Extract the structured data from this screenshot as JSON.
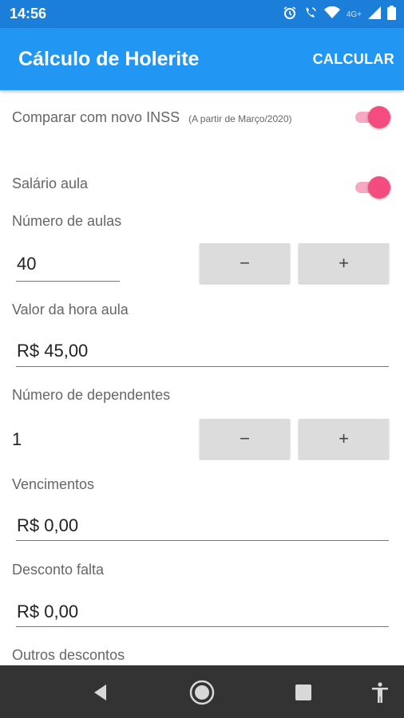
{
  "status_bar": {
    "time": "14:56",
    "network_label": "4G+",
    "icons": [
      "alarm-icon",
      "wifi-calling-icon",
      "wifi-icon",
      "signal-icon",
      "battery-icon"
    ]
  },
  "app_bar": {
    "title": "Cálculo de Holerite",
    "action_label": "CALCULAR"
  },
  "form": {
    "compare_inss": {
      "label": "Comparar com novo INSS",
      "note": "(A partir de Março/2020)",
      "enabled": true
    },
    "salario_aula": {
      "label": "Salário aula",
      "enabled": true
    },
    "numero_aulas": {
      "label": "Número de aulas",
      "value": "40",
      "minus": "−",
      "plus": "+"
    },
    "valor_hora_aula": {
      "label": "Valor da hora aula",
      "value": "R$ 45,00"
    },
    "numero_dependentes": {
      "label": "Número de dependentes",
      "value": "1",
      "minus": "−",
      "plus": "+"
    },
    "vencimentos": {
      "label": "Vencimentos",
      "value": "R$ 0,00"
    },
    "desconto_falta": {
      "label": "Desconto falta",
      "value": "R$ 0,00"
    },
    "outros_descontos": {
      "label": "Outros descontos"
    }
  },
  "nav_bar": {
    "icons": [
      "back-icon",
      "home-icon",
      "recents-icon",
      "accessibility-icon"
    ]
  },
  "colors": {
    "status_bar": "#1b7ed8",
    "app_bar": "#2196f3",
    "switch_thumb": "#f44c7f",
    "switch_track": "#f7a8c4",
    "button_bg": "#dcdcdc",
    "nav_bar": "#333333"
  }
}
